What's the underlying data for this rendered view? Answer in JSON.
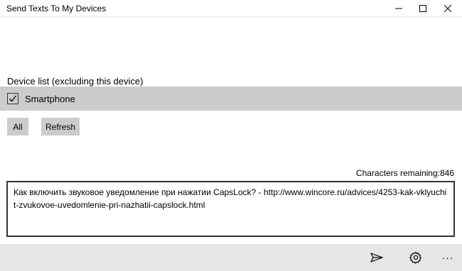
{
  "window": {
    "title": "Send Texts To My Devices"
  },
  "devices": {
    "label": "Device list (excluding this device)",
    "items": [
      {
        "name": "Smartphone",
        "checked": true
      }
    ]
  },
  "buttons": {
    "all_label": "All",
    "refresh_label": "Refresh"
  },
  "message": {
    "chars_remaining": "Characters remaining:846",
    "text": "Как включить звуковое уведомление при нажатии CapsLock? - http://www.wincore.ru/advices/4253-kak-vklyuchit-zvukovoe-uvedomlenie-pri-nazhatii-capslock.html"
  },
  "bottom_bar": {
    "icons": [
      "send-icon",
      "gear-icon",
      "more-icon"
    ],
    "more_glyph": "···"
  },
  "colors": {
    "bar_bg": "#e6e6e6",
    "row_bg": "#cccccc",
    "text": "#000000"
  }
}
